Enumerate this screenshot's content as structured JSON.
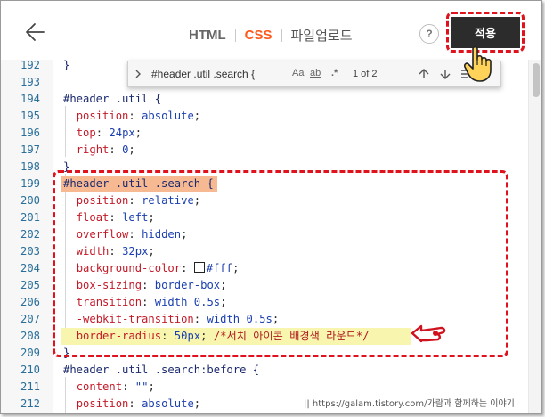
{
  "header": {
    "tabs": [
      {
        "label": "HTML",
        "active": false
      },
      {
        "label": "CSS",
        "active": true
      },
      {
        "label": "파일업로드",
        "active": false
      }
    ],
    "help_label": "?",
    "apply_label": "적용",
    "apply_button_color": "#2c2c2c",
    "active_tab_color": "#ff5a1e",
    "highlight_color": "#e0121e"
  },
  "find": {
    "query": "#header .util .search {",
    "opt_case": "Aa",
    "opt_word": "ab",
    "opt_regex": ".*",
    "count": "1 of 2"
  },
  "code_lines": [
    {
      "num": "192",
      "text": "}"
    },
    {
      "num": "193",
      "text": ""
    },
    {
      "num": "194",
      "text": "#header .util {"
    },
    {
      "num": "195",
      "prop": "position",
      "value": "absolute"
    },
    {
      "num": "196",
      "prop": "top",
      "value": "24px"
    },
    {
      "num": "197",
      "prop": "right",
      "value": "0"
    },
    {
      "num": "198",
      "text": "}"
    },
    {
      "num": "199",
      "text": "#header .util .search {"
    },
    {
      "num": "200",
      "prop": "position",
      "value": "relative"
    },
    {
      "num": "201",
      "prop": "float",
      "value": "left"
    },
    {
      "num": "202",
      "prop": "overflow",
      "value": "hidden"
    },
    {
      "num": "203",
      "prop": "width",
      "value": "32px"
    },
    {
      "num": "204",
      "prop": "background-color",
      "value": "#fff"
    },
    {
      "num": "205",
      "prop": "box-sizing",
      "value": "border-box"
    },
    {
      "num": "206",
      "prop": "transition",
      "value": "width 0.5s"
    },
    {
      "num": "207",
      "prop": "-webkit-transition",
      "value": "width 0.5s"
    },
    {
      "num": "208",
      "prop": "border-radius",
      "value": "50px",
      "comment": "/*서치 아이콘 배경색 라운드*/"
    },
    {
      "num": "209",
      "text": "}"
    },
    {
      "num": "210",
      "text": "#header .util .search:before {"
    },
    {
      "num": "211",
      "prop": "content",
      "value": "\"\""
    },
    {
      "num": "212",
      "prop": "position",
      "value": "absolute"
    }
  ],
  "watermark": "|| https://galam.tistory.com/가람과 함께하는 이야기"
}
